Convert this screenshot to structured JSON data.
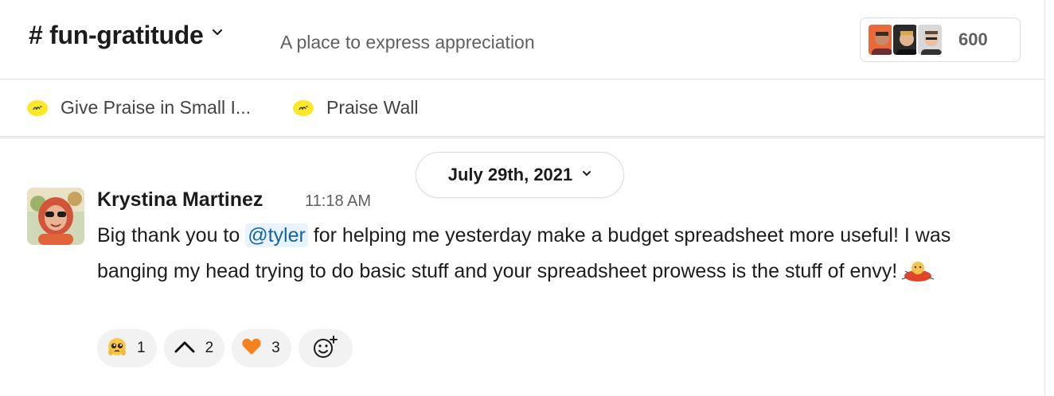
{
  "channel": {
    "name": "# fun-gratitude",
    "topic": "A place to express appreciation"
  },
  "members": {
    "count": "600",
    "icons": [
      "member-avatar-1",
      "member-avatar-2",
      "member-avatar-3"
    ]
  },
  "bookmarks": [
    {
      "label": "Give Praise in Small I...",
      "icon": "praise-icon"
    },
    {
      "label": "Praise Wall",
      "icon": "praise-icon"
    }
  ],
  "date_divider": {
    "label": "July 29th, 2021"
  },
  "message": {
    "sender": "Krystina Martinez",
    "time": "11:18 AM",
    "text_before": "Big thank you to ",
    "mention": "@tyler",
    "text_after": " for helping me yesterday make a budget spreadsheet more useful! I was banging my head trying to do basic stuff and your spreadsheet prowess is the stuff of envy!",
    "inline_emoji": "party-blob-emoji"
  },
  "reactions": [
    {
      "emoji": "pleading-face-emoji",
      "count": "1"
    },
    {
      "emoji": "caret-up-emoji",
      "count": "2"
    },
    {
      "emoji": "orange-heart-emoji",
      "count": "3"
    }
  ],
  "colors": {
    "mention_bg": "#e8f3fb",
    "mention_text": "#1264a3",
    "praise_yellow": "#fde72b",
    "reaction_bg": "#f2f2f2"
  }
}
